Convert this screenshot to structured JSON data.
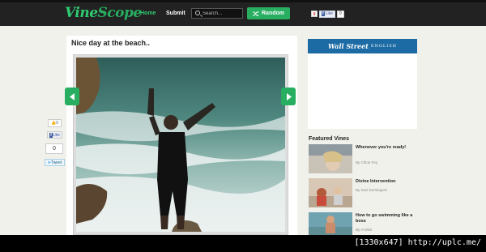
{
  "header": {
    "logo_vine": "Vine",
    "logo_scope": "Scope",
    "nav_home": "Home",
    "nav_submit": "Submit",
    "search_placeholder": "Search...",
    "random_label": "Random",
    "gplus_label": "g",
    "fb_like": "Like",
    "fb_count": "0"
  },
  "post": {
    "title": "Nice day at the beach.."
  },
  "share": {
    "gplus_count": "0",
    "fb_like": "Like",
    "count": "0",
    "tweet": "Tweet"
  },
  "ad": {
    "brand": "Wall Street",
    "sub": "ENGLISH"
  },
  "featured": {
    "heading": "Featured Vines",
    "items": [
      {
        "title": "Whenever you're ready!",
        "by": "By Chloe Fey"
      },
      {
        "title": "Divine Intervention",
        "by": "By Xavi Dominguez"
      },
      {
        "title": "How to go swimming like a boss",
        "by": "By AY2EE"
      }
    ]
  },
  "footer": {
    "watermark": "[1330x647] http://uplc.me/"
  },
  "colors": {
    "accent": "#27ae60",
    "topbar": "#222222",
    "canvas": "#f1f1ec"
  }
}
